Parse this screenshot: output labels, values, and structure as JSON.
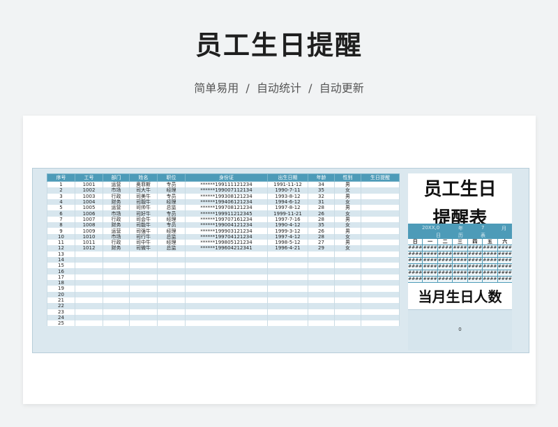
{
  "page": {
    "title": "员工生日提醒",
    "subtitle": "简单易用  /  自动统计  /  自动更新"
  },
  "table": {
    "headers": [
      "序号",
      "工号",
      "部门",
      "姓名",
      "职位",
      "身份证",
      "出生日期",
      "年龄",
      "性别",
      "生日提醒"
    ],
    "rows": [
      [
        "1",
        "1001",
        "运营",
        "奥菲斯",
        "专员",
        "******199111121234",
        "1991-11-12",
        "34",
        "男",
        ""
      ],
      [
        "2",
        "1002",
        "市场",
        "司大牛",
        "经理",
        "******199007112134",
        "1990-7-11",
        "35",
        "女",
        ""
      ],
      [
        "3",
        "1003",
        "行政",
        "司美牛",
        "专员",
        "******199308121234",
        "1993-8-12",
        "32",
        "男",
        ""
      ],
      [
        "4",
        "1004",
        "财务",
        "司靓牛",
        "经理",
        "******199406121234",
        "1994-6-12",
        "31",
        "女",
        ""
      ],
      [
        "5",
        "1005",
        "运营",
        "司帅牛",
        "总监",
        "******199708121234",
        "1997-8-12",
        "28",
        "男",
        ""
      ],
      [
        "6",
        "1006",
        "市场",
        "司好牛",
        "专员",
        "******199911212345",
        "1999-11-21",
        "26",
        "女",
        ""
      ],
      [
        "7",
        "1007",
        "行政",
        "司会牛",
        "经理",
        "******199707161234",
        "1997-7-16",
        "28",
        "男",
        ""
      ],
      [
        "8",
        "1008",
        "财务",
        "司能牛",
        "专员",
        "******199004121234",
        "1990-4-12",
        "35",
        "女",
        ""
      ],
      [
        "9",
        "1009",
        "运营",
        "司强牛",
        "经理",
        "******199903121234",
        "1999-3-12",
        "26",
        "男",
        ""
      ],
      [
        "10",
        "1010",
        "市场",
        "司行牛",
        "总监",
        "******199704121234",
        "1997-4-12",
        "28",
        "女",
        ""
      ],
      [
        "11",
        "1011",
        "行政",
        "司中牛",
        "经理",
        "******199805121234",
        "1998-5-12",
        "27",
        "男",
        ""
      ],
      [
        "12",
        "1012",
        "财务",
        "司微牛",
        "总监",
        "******199604212341",
        "1996-4-21",
        "29",
        "女",
        ""
      ],
      [
        "13",
        "",
        "",
        "",
        "",
        "",
        "",
        "",
        "",
        ""
      ],
      [
        "14",
        "",
        "",
        "",
        "",
        "",
        "",
        "",
        "",
        ""
      ],
      [
        "15",
        "",
        "",
        "",
        "",
        "",
        "",
        "",
        "",
        ""
      ],
      [
        "16",
        "",
        "",
        "",
        "",
        "",
        "",
        "",
        "",
        ""
      ],
      [
        "17",
        "",
        "",
        "",
        "",
        "",
        "",
        "",
        "",
        ""
      ],
      [
        "18",
        "",
        "",
        "",
        "",
        "",
        "",
        "",
        "",
        ""
      ],
      [
        "19",
        "",
        "",
        "",
        "",
        "",
        "",
        "",
        "",
        ""
      ],
      [
        "20",
        "",
        "",
        "",
        "",
        "",
        "",
        "",
        "",
        ""
      ],
      [
        "21",
        "",
        "",
        "",
        "",
        "",
        "",
        "",
        "",
        ""
      ],
      [
        "22",
        "",
        "",
        "",
        "",
        "",
        "",
        "",
        "",
        ""
      ],
      [
        "23",
        "",
        "",
        "",
        "",
        "",
        "",
        "",
        "",
        ""
      ],
      [
        "24",
        "",
        "",
        "",
        "",
        "",
        "",
        "",
        "",
        ""
      ],
      [
        "25",
        "",
        "",
        "",
        "",
        "",
        "",
        "",
        "",
        ""
      ]
    ]
  },
  "calendar": {
    "title_line1": "员工生日",
    "title_line2": "提醒表",
    "year": "20XX,0",
    "year_unit": "年",
    "month": "7",
    "month_unit": "月",
    "sub_left": "日",
    "sub_mid": "历",
    "sub_right": "表",
    "weekdays": [
      "日",
      "一",
      "二",
      "三",
      "四",
      "五",
      "六"
    ],
    "placeholder": "####",
    "count_label": "当月生日人数",
    "count_value": "0"
  },
  "colors": {
    "header_blue": "#4d9bb8",
    "row_alt": "#d7e6ee",
    "sheet_bg": "#dbe8ef"
  }
}
